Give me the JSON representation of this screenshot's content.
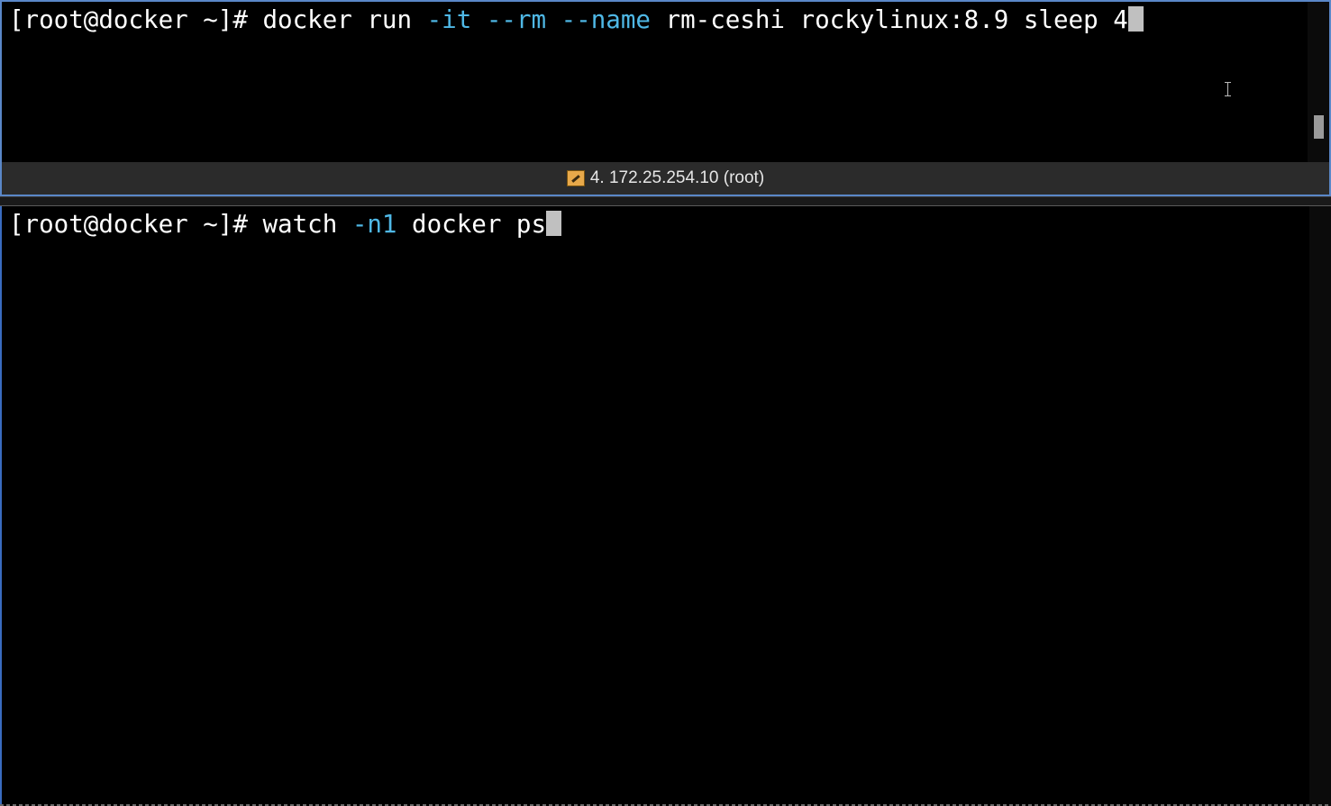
{
  "panes": {
    "top": {
      "prompt": "[root@docker ~]# ",
      "tokens": [
        {
          "text": "docker run ",
          "kind": "default"
        },
        {
          "text": "-it",
          "kind": "option"
        },
        {
          "text": " ",
          "kind": "default"
        },
        {
          "text": "--rm",
          "kind": "option"
        },
        {
          "text": " ",
          "kind": "default"
        },
        {
          "text": "--name",
          "kind": "option"
        },
        {
          "text": " rm-ceshi rockylinux:8.9 sleep 4",
          "kind": "default"
        }
      ],
      "status_label": "4. 172.25.254.10 (root)",
      "status_icon": "session-key-icon"
    },
    "bottom": {
      "prompt": "[root@docker ~]# ",
      "tokens": [
        {
          "text": "watch ",
          "kind": "default"
        },
        {
          "text": "-n1",
          "kind": "option"
        },
        {
          "text": " docker ps",
          "kind": "default"
        }
      ]
    }
  },
  "colors": {
    "background": "#000000",
    "text": "#ffffff",
    "option": "#4fb8e6",
    "cursor": "#c0c0c0",
    "active_border": "#5a87c8",
    "status_bar": "#2b2b2b"
  },
  "icons": {
    "mouse_cursor": "i-beam-cursor-icon"
  }
}
